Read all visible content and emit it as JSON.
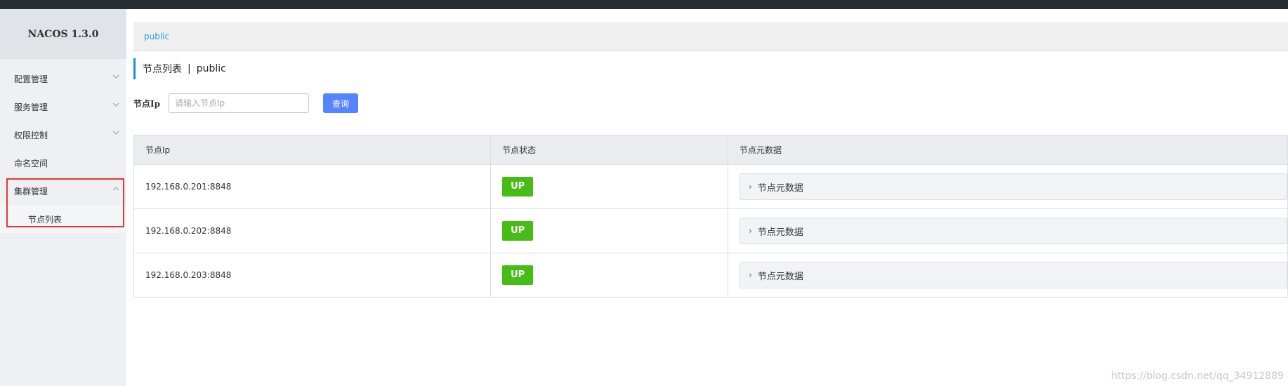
{
  "brand": {
    "title": "NACOS 1.3.0"
  },
  "sidebar": {
    "items": [
      {
        "label": "配置管理"
      },
      {
        "label": "服务管理"
      },
      {
        "label": "权限控制"
      },
      {
        "label": "命名空间"
      },
      {
        "label": "集群管理"
      }
    ],
    "submenu": [
      {
        "label": "节点列表"
      }
    ]
  },
  "namespace": {
    "link": "public"
  },
  "page": {
    "title": "节点列表",
    "separator": "|",
    "namespace": "public"
  },
  "filter": {
    "label": "节点Ip",
    "placeholder": "请输入节点Ip",
    "value": "",
    "query_label": "查询"
  },
  "table": {
    "headers": [
      "节点Ip",
      "节点状态",
      "节点元数据"
    ],
    "rows": [
      {
        "ip": "192.168.0.201:8848",
        "status": "UP",
        "meta": "节点元数据"
      },
      {
        "ip": "192.168.0.202:8848",
        "status": "UP",
        "meta": "节点元数据"
      },
      {
        "ip": "192.168.0.203:8848",
        "status": "UP",
        "meta": "节点元数据"
      }
    ]
  },
  "watermark": "https://blog.csdn.net/qq_34912889",
  "colors": {
    "accent": "#5584ff",
    "status_up": "#46bc15",
    "link": "#1ba4d8",
    "highlight": "#e53935"
  }
}
